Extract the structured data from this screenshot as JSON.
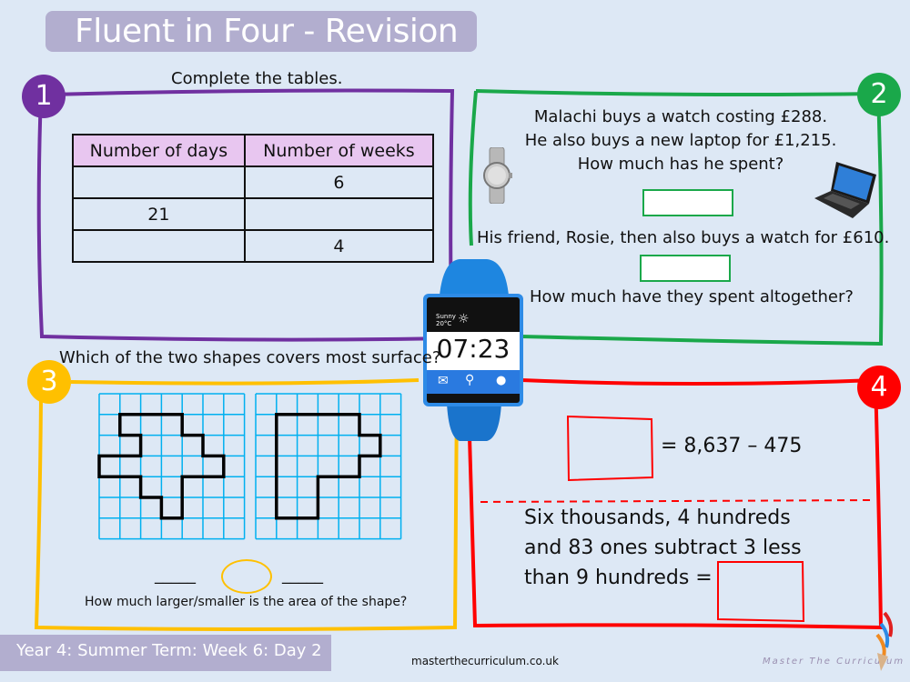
{
  "header": {
    "title": "Fluent in Four - Revision"
  },
  "colors": {
    "q1": "#7030a0",
    "q2": "#1aa84a",
    "q3": "#ffc000",
    "q4": "#ff0000",
    "grid": "#00b0f0",
    "title_bg": "#b2aecf",
    "table_header": "#e8c6f0"
  },
  "q1": {
    "number": "1",
    "instruction": "Complete the tables.",
    "table": {
      "headers": [
        "Number of days",
        "Number of weeks"
      ],
      "rows": [
        [
          "",
          "6"
        ],
        [
          "21",
          ""
        ],
        [
          "",
          "4"
        ]
      ]
    }
  },
  "q2": {
    "number": "2",
    "lines": [
      "Malachi buys a watch costing £288.",
      "He also buys a new laptop for £1,215.",
      "How much has he spent?"
    ],
    "line_rosie": "His friend, Rosie, then also buys a watch for £610.",
    "line_total": "How much have they spent altogether?",
    "answer1": "",
    "answer2": ""
  },
  "q3": {
    "number": "3",
    "question": "Which of the two shapes covers most surface?",
    "grid_size": [
      7,
      7
    ],
    "shape_a": [
      [
        1,
        1
      ],
      [
        4,
        1
      ],
      [
        4,
        2
      ],
      [
        5,
        2
      ],
      [
        5,
        3
      ],
      [
        6,
        3
      ],
      [
        6,
        4
      ],
      [
        4,
        4
      ],
      [
        4,
        6
      ],
      [
        3,
        6
      ],
      [
        3,
        5
      ],
      [
        2,
        5
      ],
      [
        2,
        4
      ],
      [
        0,
        4
      ],
      [
        0,
        3
      ],
      [
        2,
        3
      ],
      [
        2,
        2
      ],
      [
        1,
        2
      ]
    ],
    "shape_b": [
      [
        1,
        1
      ],
      [
        5,
        1
      ],
      [
        5,
        2
      ],
      [
        6,
        2
      ],
      [
        6,
        3
      ],
      [
        5,
        3
      ],
      [
        5,
        4
      ],
      [
        3,
        4
      ],
      [
        3,
        6
      ],
      [
        1,
        6
      ]
    ],
    "compare_left": "_____",
    "compare_right": "_____",
    "followup": "How much larger/smaller is the area of the shape?"
  },
  "q4": {
    "number": "4",
    "equation": "= 8,637 – 475",
    "word_problem": [
      "Six thousands, 4 hundreds",
      "and 83 ones subtract 3 less",
      "than 9 hundreds ="
    ]
  },
  "watch": {
    "weather": "Sunny",
    "temperature": "20°C",
    "time": "07:23",
    "icons": [
      "mail-icon",
      "search-icon",
      "user-icon"
    ]
  },
  "footer": {
    "lesson": "Year 4: Summer Term: Week 6: Day 2",
    "site": "masterthecurriculum.co.uk",
    "brand": "Master The Curriculum"
  }
}
